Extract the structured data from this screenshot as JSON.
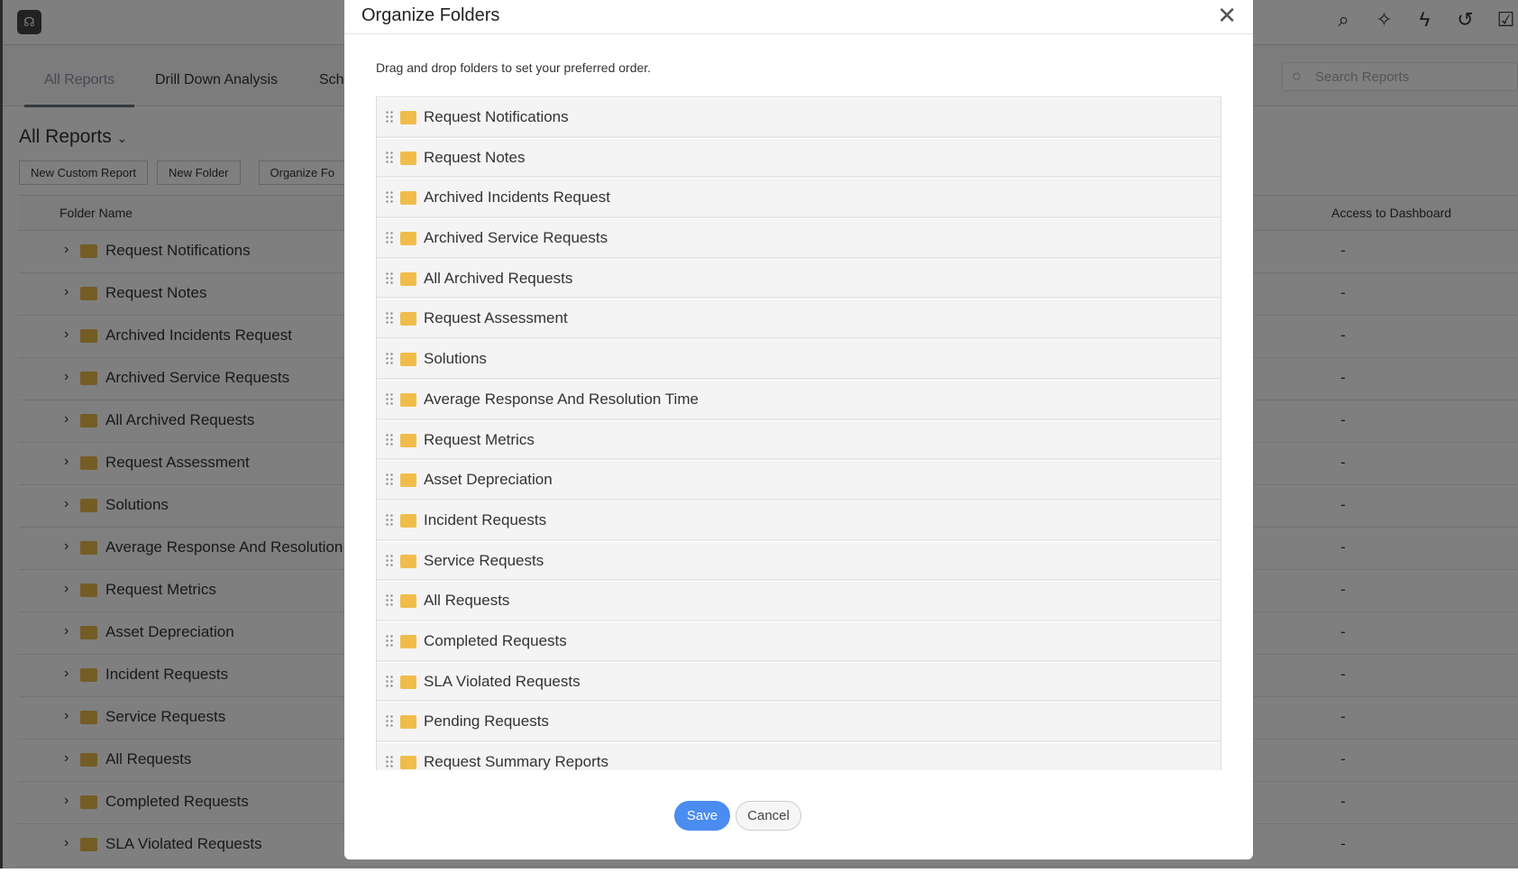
{
  "background": {
    "tabs": [
      "All Reports",
      "Drill Down Analysis",
      "Sche"
    ],
    "search_placeholder": "Search Reports",
    "heading": "All Reports",
    "buttons": [
      "New Custom Report",
      "New Folder",
      "Organize Fo"
    ],
    "columns": {
      "folder_name": "Folder Name",
      "access": "Access to Dashboard"
    },
    "rows": [
      "Request Notifications",
      "Request Notes",
      "Archived Incidents Request",
      "Archived Service Requests",
      "All Archived Requests",
      "Request Assessment",
      "Solutions",
      "Average Response And Resolution",
      "Request Metrics",
      "Asset Depreciation",
      "Incident Requests",
      "Service Requests",
      "All Requests",
      "Completed Requests",
      "SLA Violated Requests"
    ],
    "access_value": "-"
  },
  "modal": {
    "title": "Organize Folders",
    "description": "Drag and drop folders to set your preferred order.",
    "folders": [
      "Request Notifications",
      "Request Notes",
      "Archived Incidents Request",
      "Archived Service Requests",
      "All Archived Requests",
      "Request Assessment",
      "Solutions",
      "Average Response And Resolution Time",
      "Request Metrics",
      "Asset Depreciation",
      "Incident Requests",
      "Service Requests",
      "All Requests",
      "Completed Requests",
      "SLA Violated Requests",
      "Pending Requests",
      "Request Summary Reports"
    ],
    "save_label": "Save",
    "cancel_label": "Cancel"
  },
  "colors": {
    "primary": "#4a8cf0",
    "folder": "#f0bd4b"
  }
}
